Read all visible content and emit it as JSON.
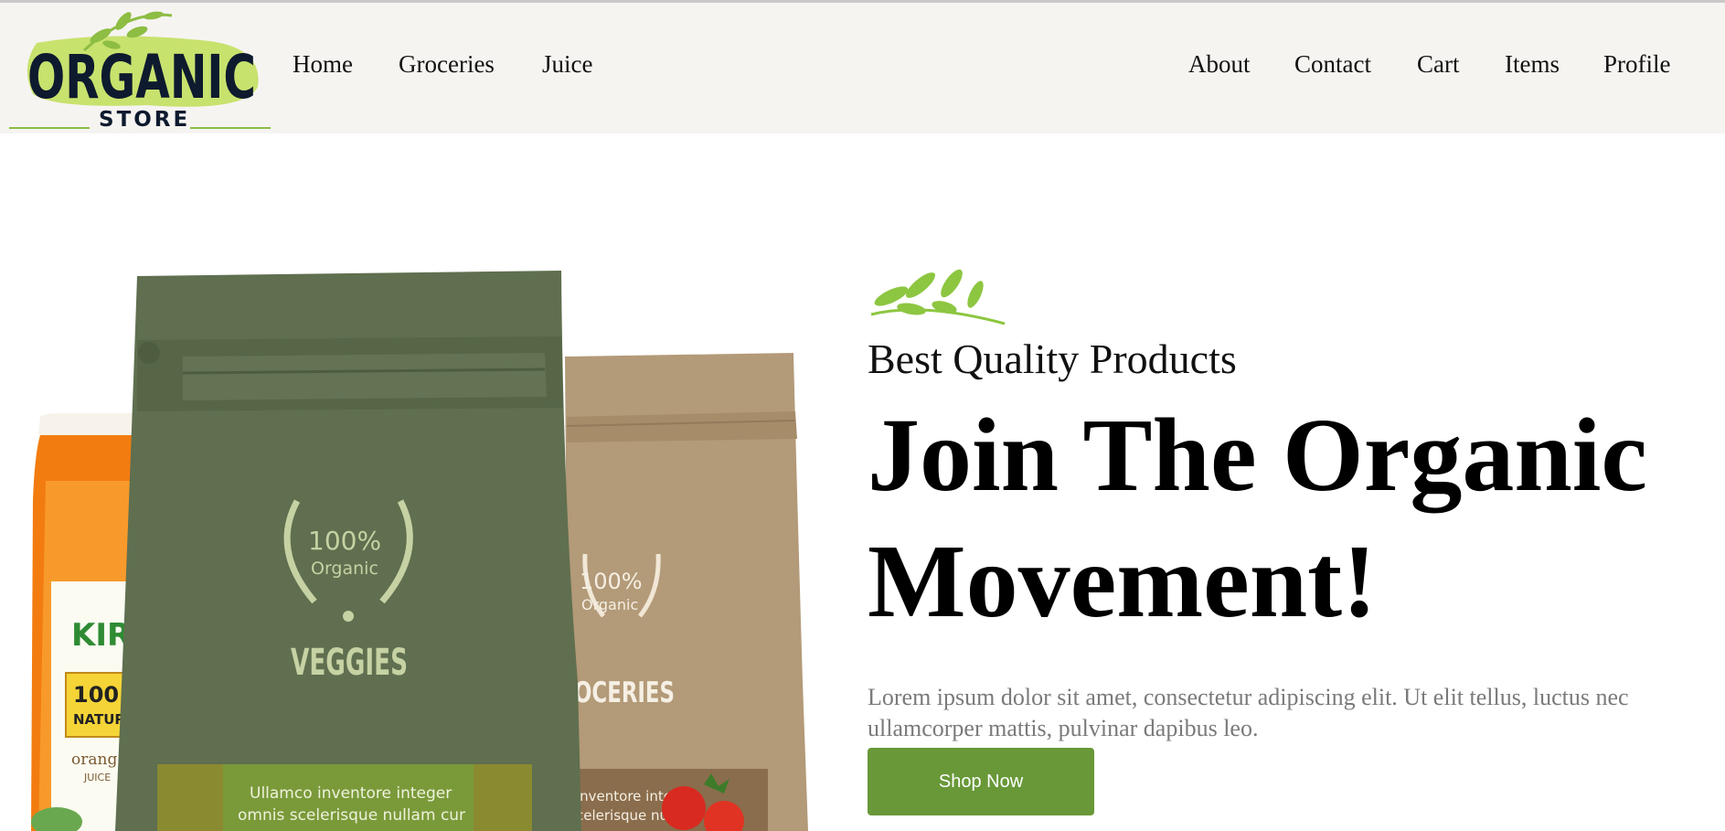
{
  "brand": {
    "logo_word": "ORGANIC",
    "logo_sub": "STORE"
  },
  "nav": {
    "left": [
      "Home",
      "Groceries",
      "Juice"
    ],
    "right": [
      "About",
      "Contact",
      "Cart",
      "Items",
      "Profile"
    ]
  },
  "hero": {
    "subtitle": "Best Quality Products",
    "title_line1": "Join The Organic",
    "title_line2": "Movement!",
    "description": "Lorem ipsum dolor sit amet, consectetur adipiscing elit. Ut elit tellus, luctus nec ullamcorper mattis, pulvinar dapibus leo.",
    "cta_label": "Shop Now"
  },
  "product_image": {
    "green_bag": {
      "percent": "100%",
      "badge_word": "Organic",
      "label": "VEGGIES",
      "strip_text": [
        "Ullamco inventore integer",
        "omnis scelerisque nullam cur"
      ]
    },
    "tan_bag": {
      "percent": "100%",
      "badge_word": "Organic",
      "label": "OCERIES",
      "strip_text": [
        "inventore integer",
        "celerisque null"
      ]
    },
    "jar": {
      "brand": "KIRI",
      "percent": "100",
      "natural": "NATUR",
      "flavor": "orang",
      "juice": "JUICE"
    }
  },
  "colors": {
    "accent": "#689838",
    "header_bg": "#f6f4f1",
    "logo_ink": "#0e1a2e",
    "logo_blob": "#c8e26e"
  }
}
